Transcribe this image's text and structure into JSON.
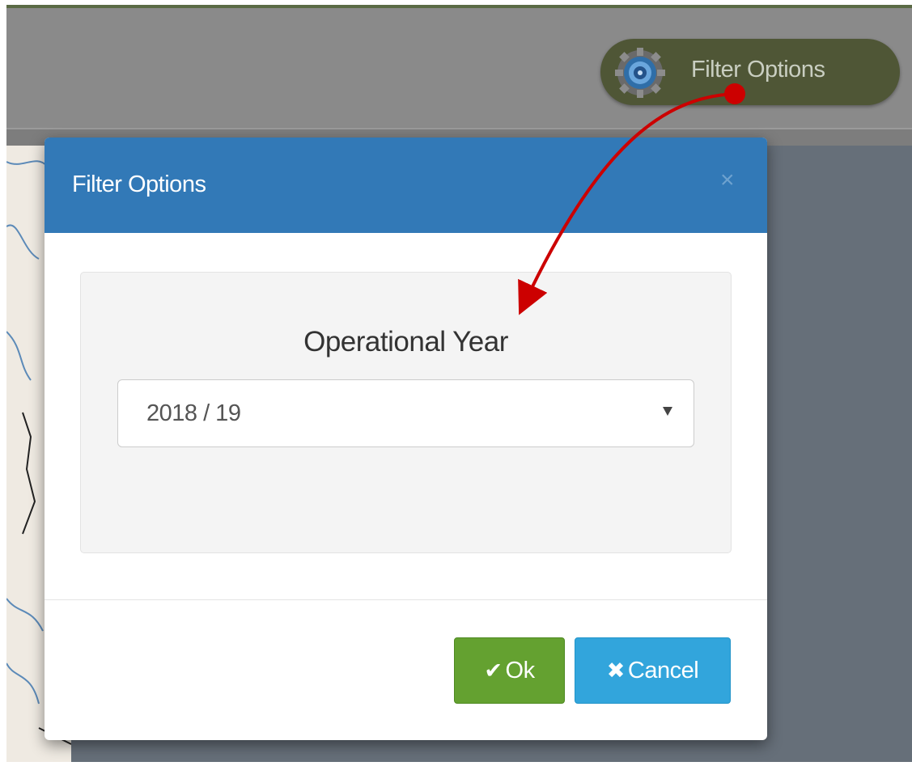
{
  "header": {
    "filter_button_label": "Filter Options",
    "filter_icon": "gear-icon"
  },
  "modal": {
    "title": "Filter Options",
    "close_label": "×",
    "field_label": "Operational Year",
    "selected_year": "2018 / 19",
    "ok_icon": "✔",
    "ok_label": "Ok",
    "cancel_icon": "✖",
    "cancel_label": "Cancel"
  },
  "colors": {
    "modal_header": "#3279b7",
    "ok_button": "#64a130",
    "cancel_button": "#32a5dc",
    "filter_pill": "#4f5636",
    "annotation_arrow": "#cc0000"
  }
}
